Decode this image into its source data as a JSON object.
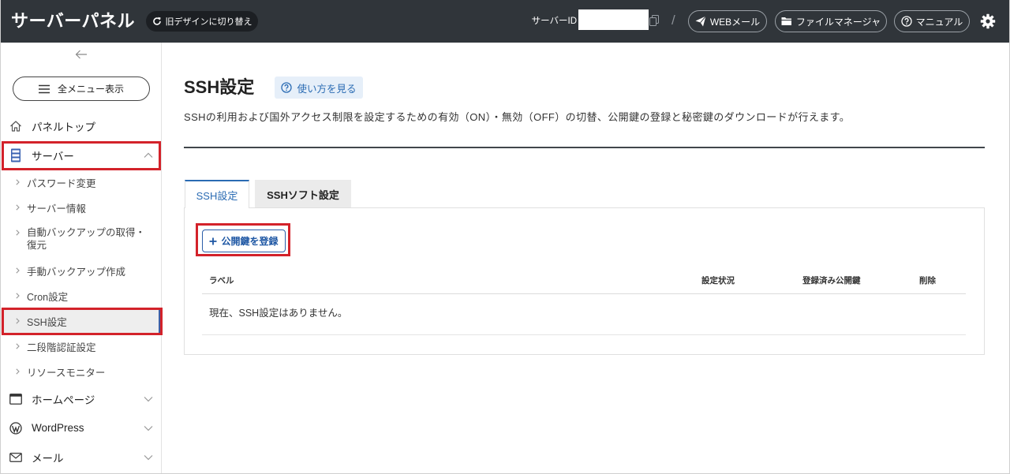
{
  "colors": {
    "header_bg": "#30353a",
    "accent": "#2a6bb3",
    "highlight_annotation": "#d3222a"
  },
  "header": {
    "title": "サーバーパネル",
    "switch_design": {
      "label": "旧デザインに切り替え",
      "icon": "refresh-icon"
    },
    "server_id": {
      "label": "サーバーID",
      "copy_icon": "copy-icon"
    },
    "separator": "/",
    "links": [
      {
        "label": "WEBメール",
        "icon": "paper-plane-icon"
      },
      {
        "label": "ファイルマネージャ",
        "icon": "folder-icon"
      },
      {
        "label": "マニュアル",
        "icon": "help-circle-icon"
      }
    ],
    "settings_icon": "gear-icon"
  },
  "sidebar": {
    "collapse_icon": "arrow-left-icon",
    "all_menu": {
      "label": "全メニュー表示",
      "icon": "hamburger-icon"
    },
    "items": [
      {
        "label": "パネルトップ",
        "icon": "home-icon"
      },
      {
        "label": "サーバー",
        "icon": "server-icon",
        "expanded": true,
        "highlighted": true,
        "children": [
          {
            "label": "パスワード変更"
          },
          {
            "label": "サーバー情報"
          },
          {
            "label": "自動バックアップの取得・復元"
          },
          {
            "label": "手動バックアップ作成"
          },
          {
            "label": "Cron設定"
          },
          {
            "label": "SSH設定",
            "active": true,
            "highlighted": true
          },
          {
            "label": "二段階認証設定"
          },
          {
            "label": "リソースモニター"
          }
        ]
      },
      {
        "label": "ホームページ",
        "icon": "browser-icon",
        "expanded": false
      },
      {
        "label": "WordPress",
        "icon": "wordpress-icon",
        "expanded": false
      },
      {
        "label": "メール",
        "icon": "envelope-icon",
        "expanded": false
      }
    ]
  },
  "main": {
    "title": "SSH設定",
    "help": {
      "label": "使い方を見る",
      "icon": "help-circle-icon"
    },
    "description": "SSHの利用および国外アクセス制限を設定するための有効（ON）・無効（OFF）の切替、公開鍵の登録と秘密鍵のダウンロードが行えます。",
    "tabs": [
      {
        "label": "SSH設定",
        "active": true
      },
      {
        "label": "SSHソフト設定",
        "active": false
      }
    ],
    "register_key": {
      "label": "公開鍵を登録",
      "icon": "plus-icon",
      "highlighted": true
    },
    "table": {
      "columns": [
        "ラベル",
        "設定状況",
        "登録済み公開鍵",
        "削除"
      ],
      "empty_message": "現在、SSH設定はありません。"
    }
  }
}
